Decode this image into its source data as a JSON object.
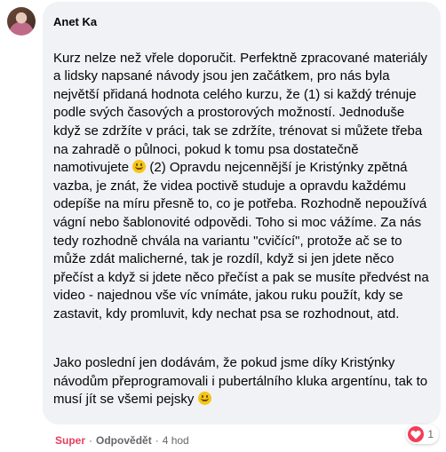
{
  "comment": {
    "author": "Anet Ka",
    "paragraphs": [
      {
        "parts": [
          "Kurz nelze než vřele doporučit. Perfektně zpracované materiály a lidsky napsané návody jsou jen začátkem, pro nás byla největší přidaná hodnota celého kurzu, že (1) si každý trénuje podle svých časových a prostorových možností. Jednoduše když se zdržíte v práci, tak se zdržíte, trénovat si můžete třeba na zahradě o půlnoci, pokud k tomu psa dostatečně namotivujete ",
          " (2) Opravdu nejcennější je Kristýnky zpětná vazba, je znát, že videa poctivě studuje a opravdu každému odepíše na míru přesně to, co je potřeba. Rozhodně nepoužívá vágní nebo šablonovité odpovědi. Toho si moc vážíme. Za nás tedy rozhodně chvála na variantu \"cvičící\", protože ač se to může zdát malicherné, tak je rozdíl, když si jen jdete něco přečíst a když si jdete něco přečíst a pak se musíte předvést na video - najednou vše víc vnímáte, jakou ruku použít, kdy se zastavit, kdy promluvit, kdy nechat psa se rozhodnout, atd."
        ]
      },
      {
        "parts": [
          "Jako poslední jen dodávám, že pokud jsme díky Kristýnky návodům přeprogramovali i pubertálního kluka argentínu, tak to musí jít se všemi pejsky "
        ]
      }
    ],
    "emoji": "smiling-face-emoji"
  },
  "actions": {
    "like_label": "Super",
    "separator": "·",
    "reply_label": "Odpovědět",
    "time": "4 hod"
  },
  "reactions": {
    "icon": "heart-icon",
    "count": "1",
    "color": "#f33e58"
  }
}
